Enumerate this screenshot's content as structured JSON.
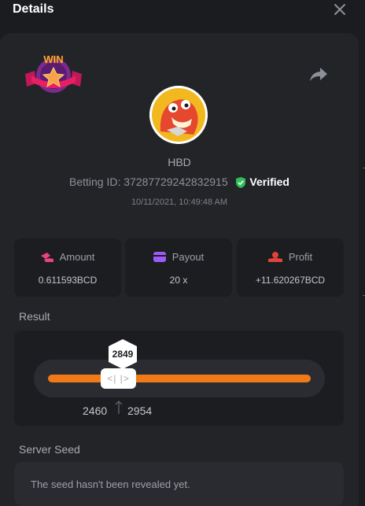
{
  "header": {
    "title": "Details"
  },
  "bet": {
    "username": "HBD",
    "betting_id_label": "Betting ID:",
    "betting_id": "37287729242832915",
    "verified_label": "Verified",
    "timestamp": "10/11/2021, 10:49:48 AM"
  },
  "stats": [
    {
      "label": "Amount",
      "value": "0.611593BCD",
      "icon": "coins-icon",
      "color": "#e8457a"
    },
    {
      "label": "Payout",
      "value": "20 x",
      "icon": "wallet-icon",
      "color": "#9b5cf6"
    },
    {
      "label": "Profit",
      "value": "+11.620267BCD",
      "icon": "hand-coin-icon",
      "color": "#e0433a"
    }
  ],
  "result": {
    "label": "Result",
    "value": "2849",
    "range_low": "2460",
    "range_high": "2954",
    "thumb_text": "<| |>",
    "accent": "#f07a17"
  },
  "server_seed": {
    "label": "Server Seed",
    "text": "The seed hasn't been revealed yet."
  },
  "badge": {
    "text": "WIN"
  }
}
